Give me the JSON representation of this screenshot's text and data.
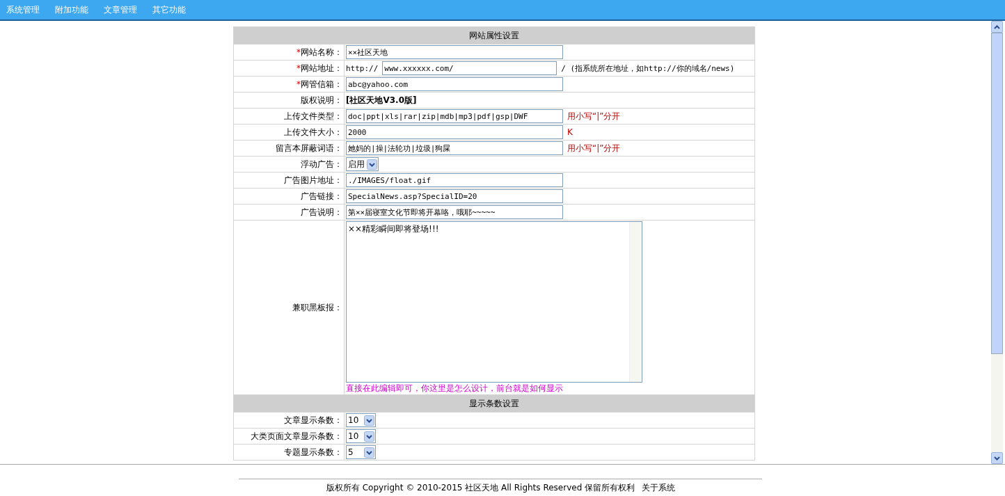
{
  "nav": [
    "系统管理",
    "附加功能",
    "文章管理",
    "其它功能"
  ],
  "sections": [
    {
      "title": "网站属性设置",
      "rows": [
        {
          "label": "网站名称：",
          "required_mark": "*",
          "kind": "input",
          "value": "××社区天地"
        },
        {
          "label": "网站地址：",
          "required_mark": "*",
          "kind": "url",
          "prefix": "http://",
          "value": "www.xxxxxx.com/",
          "after": "/ (指系统所在地址，如http://你的域名/news)"
        },
        {
          "label": "网管信箱：",
          "required_mark": "*",
          "kind": "input",
          "value": "abc@yahoo.com"
        },
        {
          "label": "版权说明：",
          "kind": "bold",
          "value": "[社区天地V3.0版]"
        },
        {
          "label": "上传文件类型：",
          "kind": "input",
          "value": "doc|ppt|xls|rar|zip|mdb|mp3|pdf|gsp|DWF",
          "note": "用小写“|”分开"
        },
        {
          "label": "上传文件大小：",
          "kind": "input",
          "value": "2000",
          "note": "K"
        },
        {
          "label": "留言本屏蔽词语：",
          "kind": "input",
          "value": "她妈的|操|法轮功|垃圾|狗屎",
          "note": "用小写“|”分开"
        },
        {
          "label": "浮动广告：",
          "kind": "select",
          "value": "启用"
        },
        {
          "label": "广告图片地址：",
          "kind": "input",
          "value": "./IMAGES/float.gif"
        },
        {
          "label": "广告链接：",
          "kind": "input",
          "value": "SpecialNews.asp?SpecialID=20"
        },
        {
          "label": "广告说明：",
          "kind": "input",
          "value": "第××届寝室文化节即将开幕咯，哦耶~~~~~"
        },
        {
          "label": "兼职黑板报：",
          "kind": "textarea",
          "value": "××精彩瞬间即将登场!!!",
          "hint": "直接在此编辑即可，你这里是怎么设计，前台就是如何显示"
        }
      ]
    },
    {
      "title": "显示条数设置",
      "rows": [
        {
          "label": "文章显示条数：",
          "kind": "select",
          "value": "10"
        },
        {
          "label": "大类页面文章显示条数：",
          "kind": "select",
          "value": "10"
        },
        {
          "label": "专题显示条数：",
          "kind": "select",
          "value": "5"
        }
      ]
    }
  ],
  "footer": {
    "text": "版权所有 Copyright © 2010-2015 社区天地 All Rights Reserved 保留所有权利",
    "link": "关于系统"
  }
}
